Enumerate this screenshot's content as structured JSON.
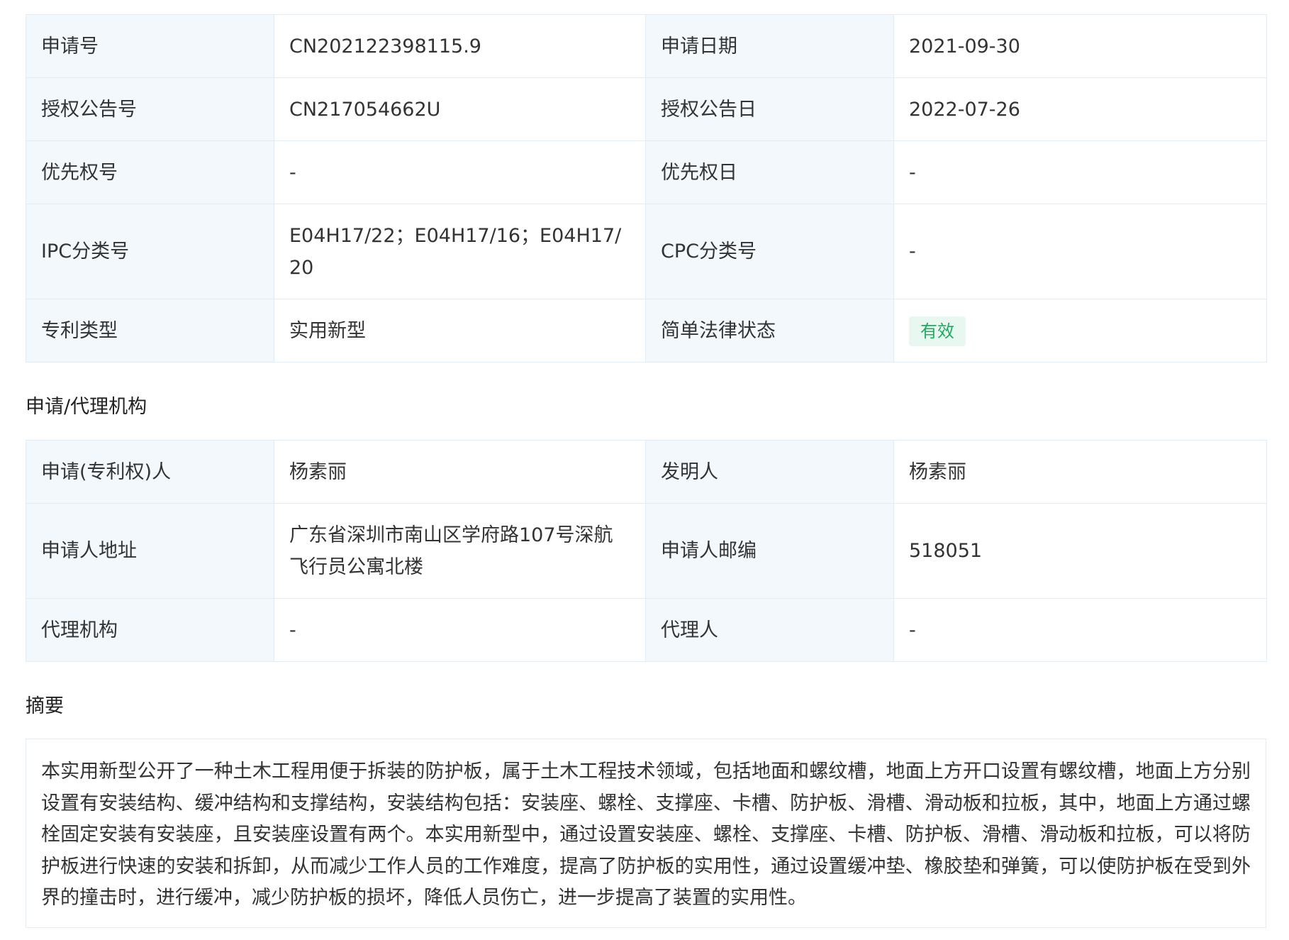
{
  "basic_info": {
    "rows": [
      {
        "label1": "申请号",
        "value1": "CN202122398115.9",
        "label2": "申请日期",
        "value2": "2021-09-30"
      },
      {
        "label1": "授权公告号",
        "value1": "CN217054662U",
        "label2": "授权公告日",
        "value2": "2022-07-26"
      },
      {
        "label1": "优先权号",
        "value1": "-",
        "label2": "优先权日",
        "value2": "-"
      },
      {
        "label1": "IPC分类号",
        "value1": "E04H17/22；E04H17/16；E04H17/20",
        "label2": "CPC分类号",
        "value2": "-"
      },
      {
        "label1": "专利类型",
        "value1": "实用新型",
        "label2": "简单法律状态",
        "value2": "有效"
      }
    ]
  },
  "agency_section": {
    "title": "申请/代理机构",
    "rows": [
      {
        "label1": "申请(专利权)人",
        "value1": "杨素丽",
        "label2": "发明人",
        "value2": "杨素丽"
      },
      {
        "label1": "申请人地址",
        "value1": "广东省深圳市南山区学府路107号深航飞行员公寓北楼",
        "label2": "申请人邮编",
        "value2": "518051"
      },
      {
        "label1": "代理机构",
        "value1": "-",
        "label2": "代理人",
        "value2": "-"
      }
    ]
  },
  "abstract_section": {
    "title": "摘要",
    "text": "本实用新型公开了一种土木工程用便于拆装的防护板，属于土木工程技术领域，包括地面和螺纹槽，地面上方开口设置有螺纹槽，地面上方分别设置有安装结构、缓冲结构和支撑结构，安装结构包括：安装座、螺栓、支撑座、卡槽、防护板、滑槽、滑动板和拉板，其中，地面上方通过螺栓固定安装有安装座，且安装座设置有两个。本实用新型中，通过设置安装座、螺栓、支撑座、卡槽、防护板、滑槽、滑动板和拉板，可以将防护板进行快速的安装和拆卸，从而减少工作人员的工作难度，提高了防护板的实用性，通过设置缓冲垫、橡胶垫和弹簧，可以使防护板在受到外界的撞击时，进行缓冲，减少防护板的损坏，降低人员伤亡，进一步提高了装置的实用性。"
  },
  "colors": {
    "label_bg": "#f2f8fc",
    "border": "#e4ecf3",
    "status_green": "#21a862",
    "status_bg": "#e8f7ef"
  }
}
